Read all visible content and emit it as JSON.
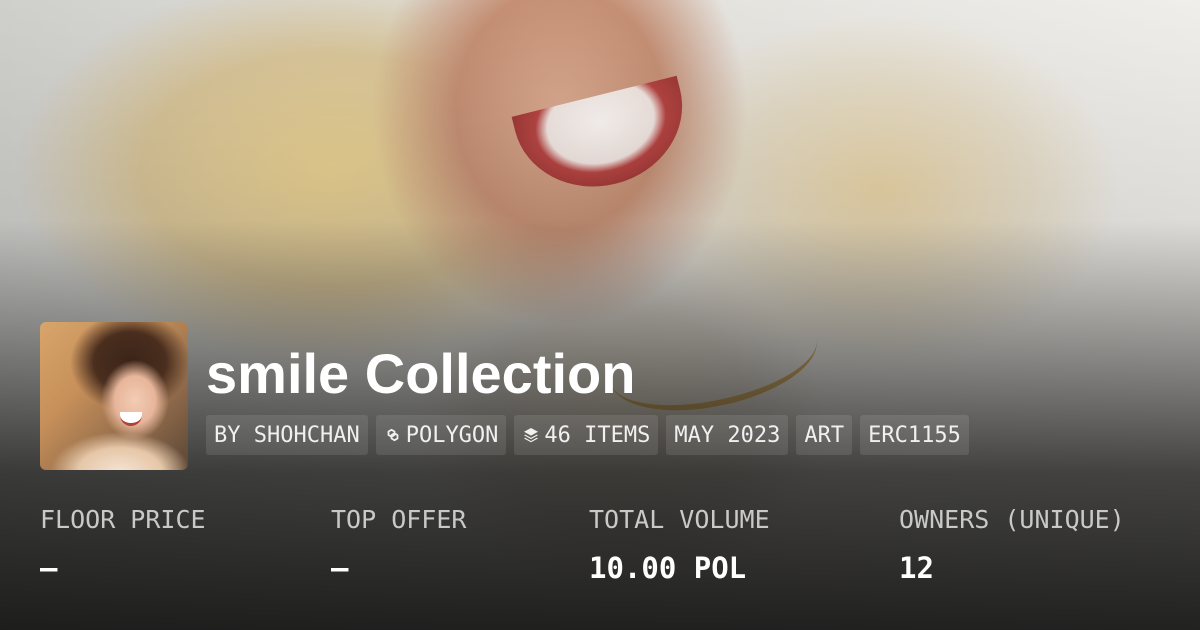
{
  "collection": {
    "title": "smile Collection",
    "avatar_alt": "collection avatar"
  },
  "tags": [
    {
      "label": "BY SHOHCHAN",
      "icon": ""
    },
    {
      "label": "POLYGON",
      "icon": "polygon-icon"
    },
    {
      "label": "46 ITEMS",
      "icon": "layers-icon"
    },
    {
      "label": "MAY 2023",
      "icon": ""
    },
    {
      "label": "ART",
      "icon": ""
    },
    {
      "label": "ERC1155",
      "icon": ""
    }
  ],
  "stats": [
    {
      "label": "FLOOR PRICE",
      "value": "—"
    },
    {
      "label": "TOP OFFER",
      "value": "—"
    },
    {
      "label": "TOTAL VOLUME",
      "value": "10.00 POL"
    },
    {
      "label": "OWNERS (UNIQUE)",
      "value": "12"
    }
  ],
  "colors": {
    "text": "#ffffff",
    "label": "#c9c9c9",
    "tag_bg": "rgba(255,255,255,0.10)"
  }
}
